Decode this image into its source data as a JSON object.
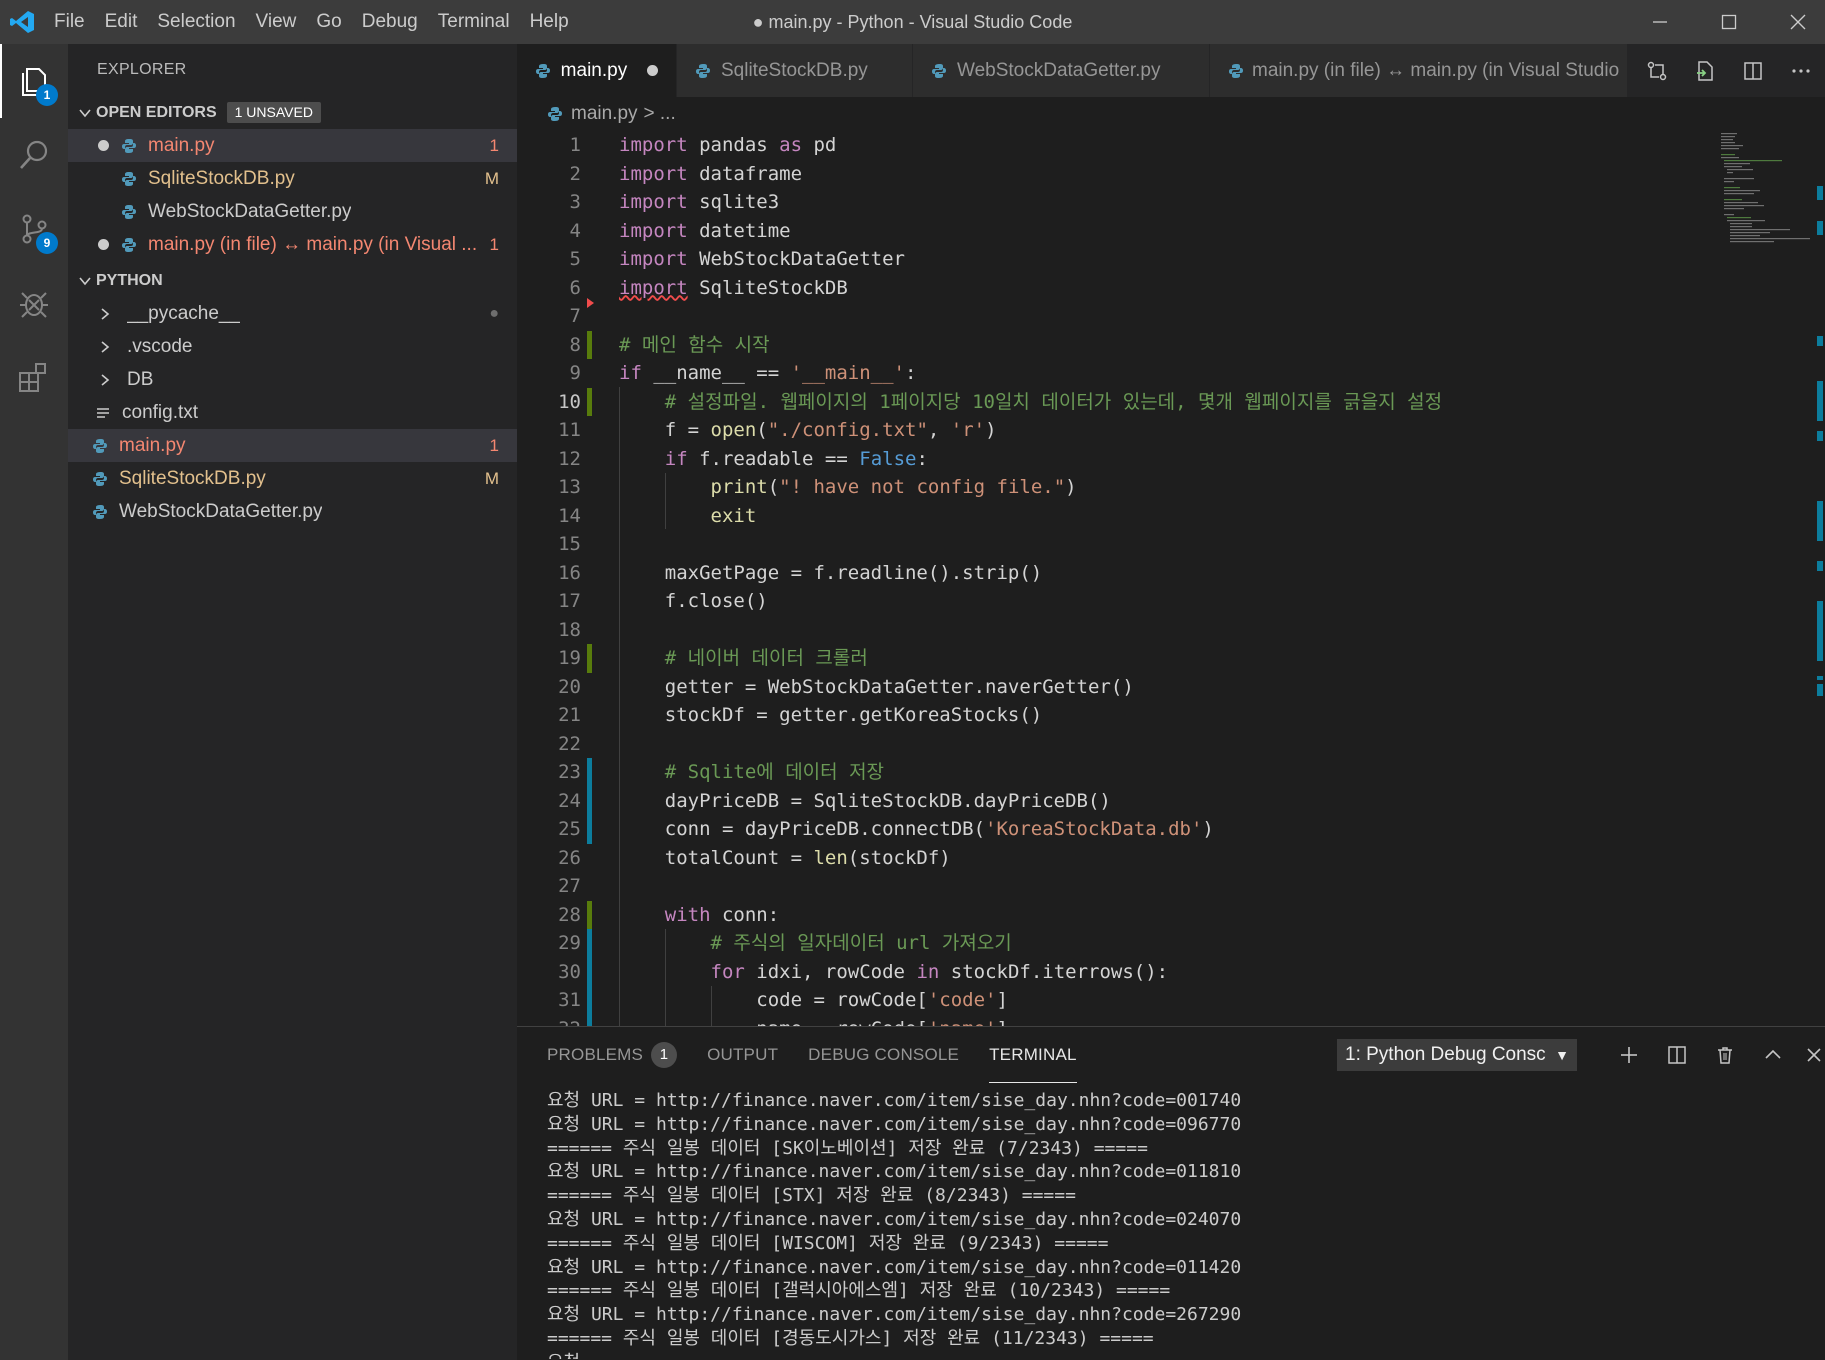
{
  "window": {
    "title": "● main.py - Python - Visual Studio Code",
    "menu": [
      "File",
      "Edit",
      "Selection",
      "View",
      "Go",
      "Debug",
      "Terminal",
      "Help"
    ]
  },
  "activity_bar": {
    "explorer_badge": "1",
    "scm_badge": "9"
  },
  "sidebar": {
    "title": "EXPLORER",
    "open_editors": {
      "label": "OPEN EDITORS",
      "badge": "1 UNSAVED",
      "items": [
        {
          "name": "main.py",
          "decoration": "1"
        },
        {
          "name": "SqliteStockDB.py",
          "decoration": "M"
        },
        {
          "name": "WebStockDataGetter.py",
          "decoration": ""
        },
        {
          "name": "main.py (in file) ↔ main.py (in Visual ...",
          "decoration": "1"
        }
      ]
    },
    "folder": {
      "label": "PYTHON",
      "items": [
        {
          "name": "__pycache__",
          "decoration": "●"
        },
        {
          "name": ".vscode",
          "decoration": ""
        },
        {
          "name": "DB",
          "decoration": ""
        },
        {
          "name": "config.txt",
          "decoration": ""
        },
        {
          "name": "main.py",
          "decoration": "1"
        },
        {
          "name": "SqliteStockDB.py",
          "decoration": "M"
        },
        {
          "name": "WebStockDataGetter.py",
          "decoration": ""
        }
      ]
    }
  },
  "tabs": [
    {
      "label": "main.py"
    },
    {
      "label": "SqliteStockDB.py"
    },
    {
      "label": "WebStockDataGetter.py"
    },
    {
      "label": "main.py (in file) ↔ main.py (in Visual Studio"
    }
  ],
  "breadcrumb": {
    "file": "main.py",
    "rest": "> ..."
  },
  "editor": {
    "line_numbers": [
      "1",
      "2",
      "3",
      "4",
      "5",
      "6",
      "7",
      "8",
      "9",
      "10",
      "11",
      "12",
      "13",
      "14",
      "15",
      "16",
      "17",
      "18",
      "19",
      "20",
      "21",
      "22",
      "23",
      "24",
      "25",
      "26",
      "27",
      "28",
      "29",
      "30",
      "31",
      "32"
    ]
  },
  "panel": {
    "tabs": {
      "problems": "PROBLEMS",
      "problems_count": "1",
      "output": "OUTPUT",
      "debug_console": "DEBUG CONSOLE",
      "terminal": "TERMINAL"
    },
    "terminal_select": "1: Python Debug Consc",
    "terminal_lines": [
      "요청 URL = http://finance.naver.com/item/sise_day.nhn?code=001740",
      "요청 URL = http://finance.naver.com/item/sise_day.nhn?code=096770",
      "====== 주식 일봉 데이터 [SK이노베이션] 저장 완료 (7/2343) =====",
      "요청 URL = http://finance.naver.com/item/sise_day.nhn?code=011810",
      "====== 주식 일봉 데이터 [STX] 저장 완료 (8/2343) =====",
      "요청 URL = http://finance.naver.com/item/sise_day.nhn?code=024070",
      "====== 주식 일봉 데이터 [WISCOM] 저장 완료 (9/2343) =====",
      "요청 URL = http://finance.naver.com/item/sise_day.nhn?code=011420",
      "====== 주식 일봉 데이터 [갤럭시아에스엠] 저장 완료 (10/2343) =====",
      "요청 URL = http://finance.naver.com/item/sise_day.nhn?code=267290",
      "====== 주식 일봉 데이터 [경동도시가스] 저장 완료 (11/2343) =====",
      "요청"
    ]
  },
  "colors": {
    "accent": "#007acc",
    "modified_red": "#f48771",
    "modified_yellow": "#e2c08d",
    "gutter_added": "#587c0c",
    "gutter_modified": "#0c7d9d"
  }
}
